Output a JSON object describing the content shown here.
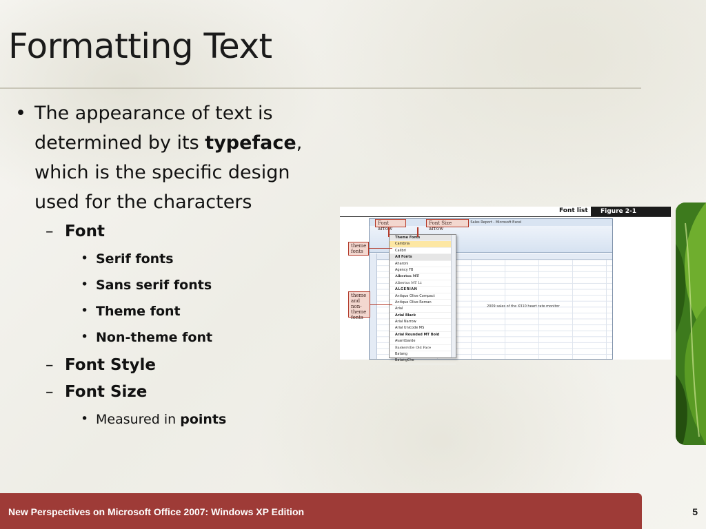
{
  "slide": {
    "title": "Formatting Text",
    "page_number": "5",
    "footer": "New Perspectives on Microsoft Office 2007: Windows XP Edition"
  },
  "bullets": {
    "main_pre": "The appearance of text is determined by its",
    "main_bold": "typeface",
    "main_post": ", which is the specific design used for the characters",
    "font": {
      "label": "Font",
      "items": [
        "Serif fonts",
        "Sans serif fonts",
        "Theme font",
        "Non-theme font"
      ]
    },
    "font_style": "Font Style",
    "font_size": {
      "label": "Font Size",
      "measured_pre": "Measured in",
      "measured_bold": "points"
    }
  },
  "figure": {
    "list_label": "Font list",
    "figure_label": "Figure 2-1",
    "callout_font_arrow": "Font arrow",
    "callout_font_size_arrow": "Font Size arrow",
    "callout_theme_fonts": "theme fonts",
    "callout_theme_non_theme": "theme and non-theme fonts",
    "window_title": "... Sales Report - Microsoft Excel",
    "sales_text": "2009 sales of the X310 heart rate monitor",
    "font_items": [
      "Theme Fonts",
      "Cambria",
      "Calibri",
      "All Fonts",
      "Aharoni",
      "Agency FB",
      "Albertus MT",
      "Albertus MT Lt",
      "ALGERIAN",
      "Antique Olive Compact",
      "Antique Olive Roman",
      "Arial",
      "Arial Black",
      "Arial Narrow",
      "Arial Unicode MS",
      "Arial Rounded MT Bold",
      "AvantGarde",
      "Baskerville Old Face",
      "Batang",
      "BatangChe"
    ]
  },
  "colors": {
    "footer_bg": "#9e3b37",
    "title_rule": "#c9c6b8",
    "callout_border": "#b33a2a"
  }
}
